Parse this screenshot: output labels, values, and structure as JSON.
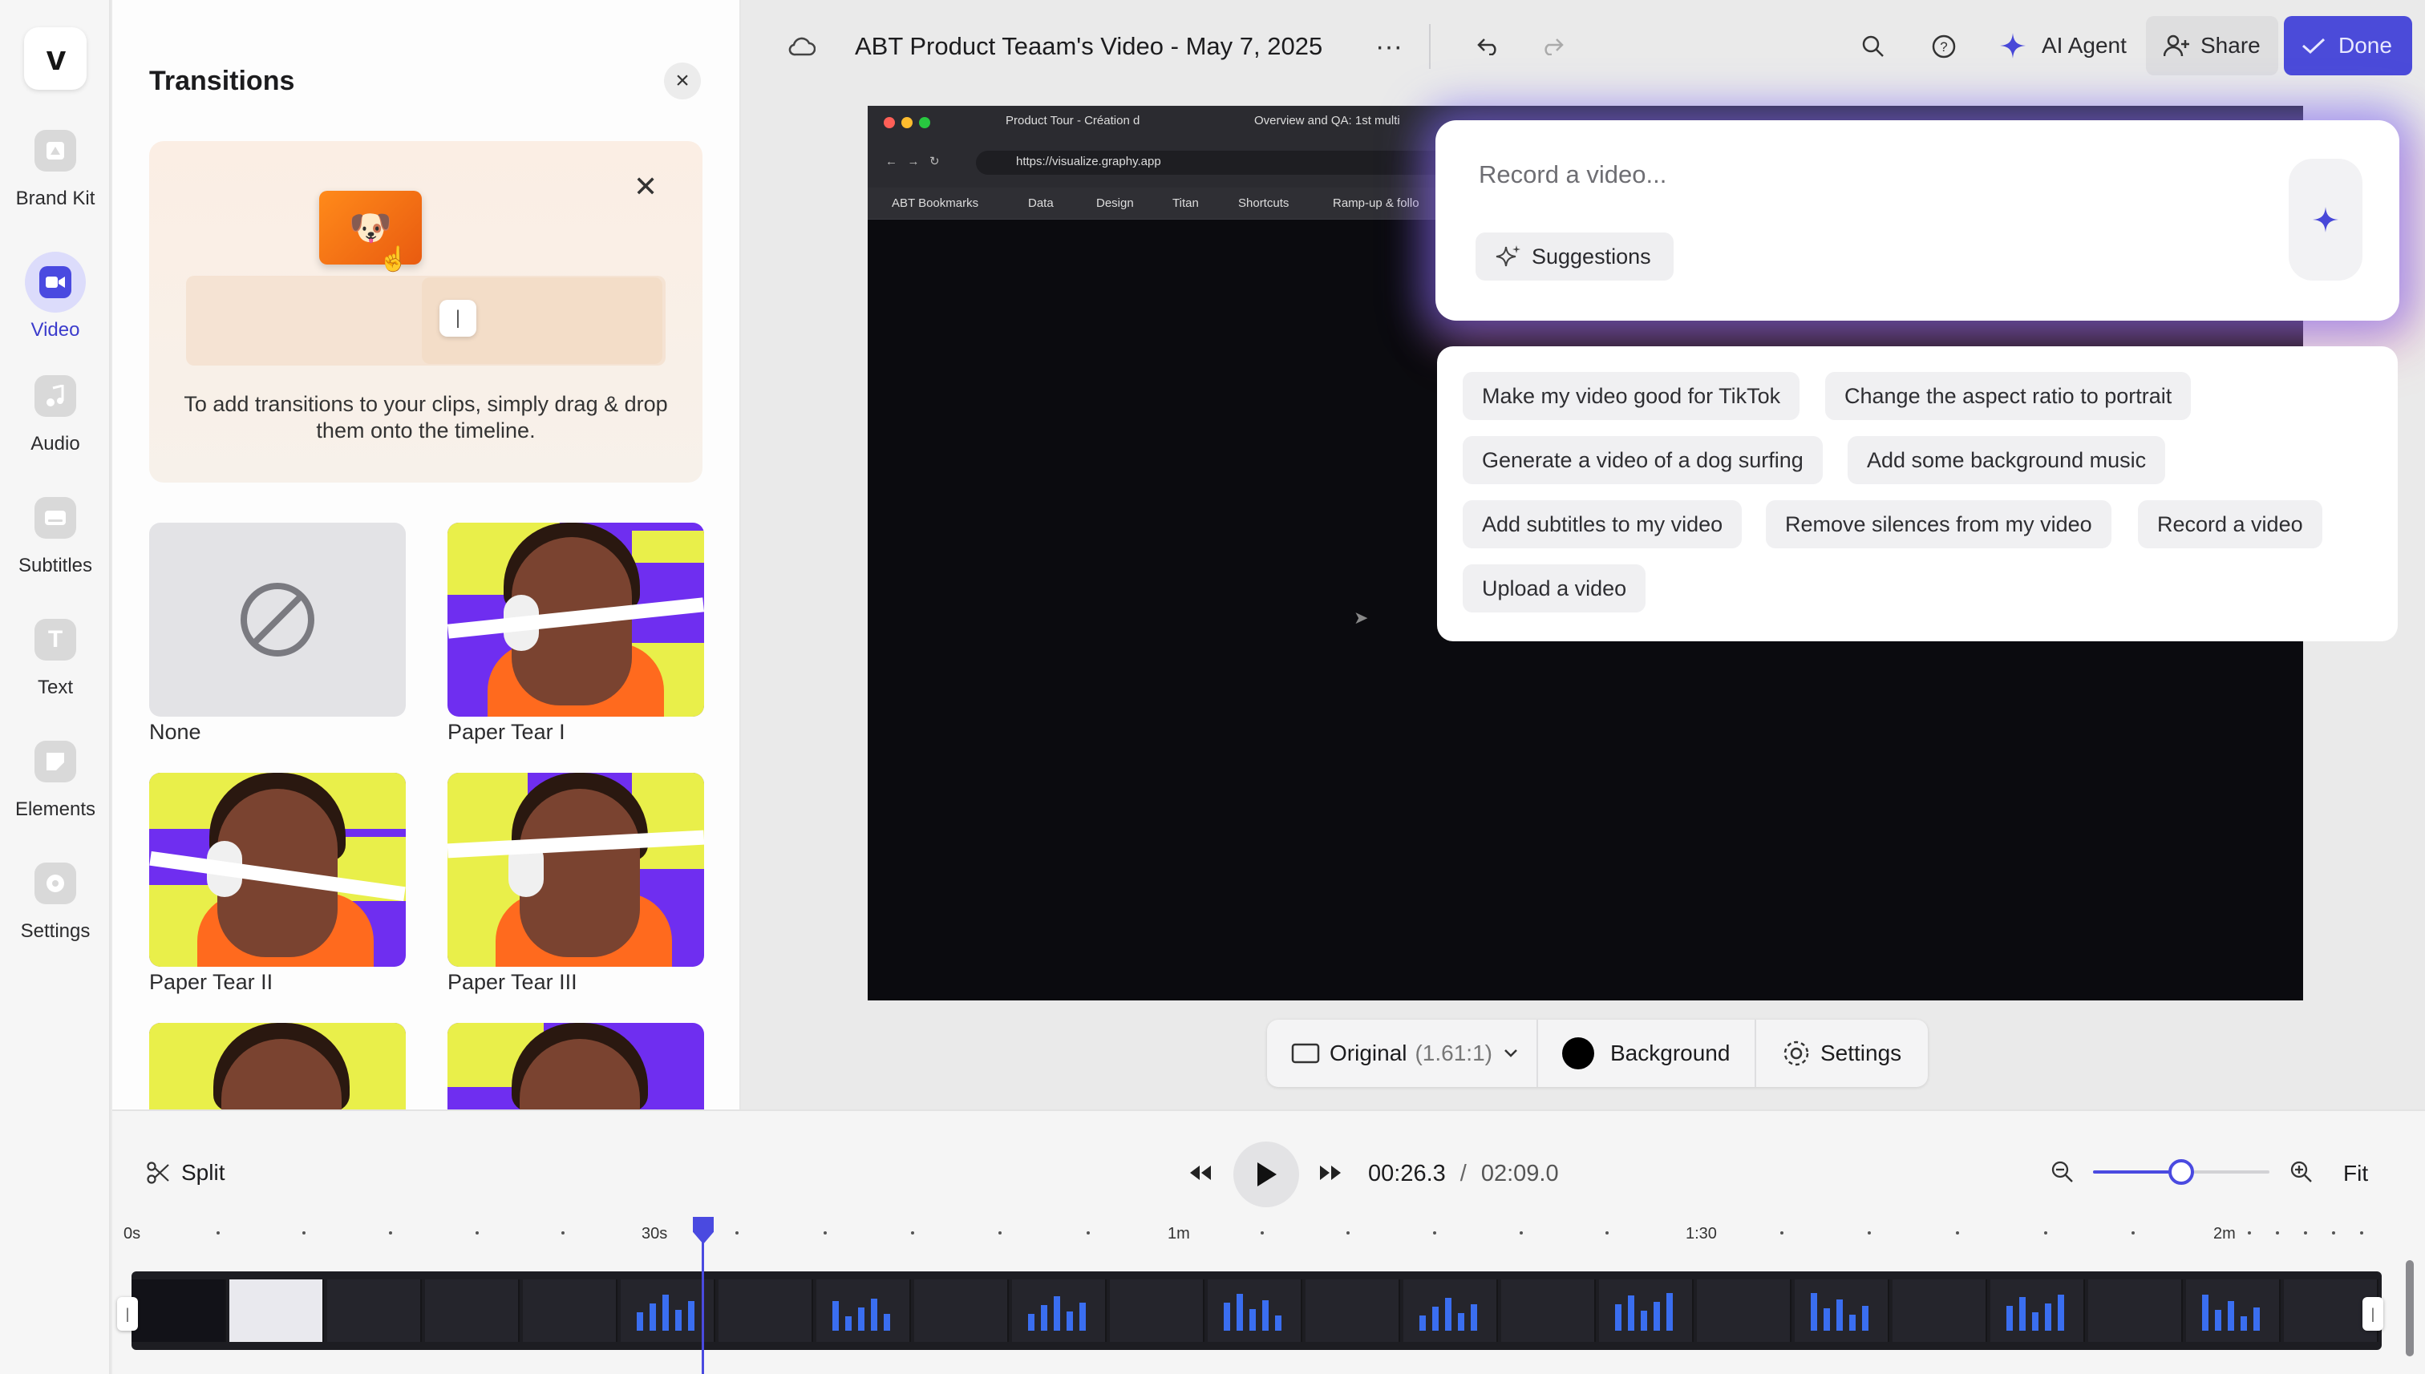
{
  "rail": {
    "logo": "v",
    "items": [
      {
        "label": "Brand Kit",
        "icon": "brand-kit-icon"
      },
      {
        "label": "Video",
        "icon": "video-icon",
        "active": true
      },
      {
        "label": "Audio",
        "icon": "music-note-icon"
      },
      {
        "label": "Subtitles",
        "icon": "subtitles-icon"
      },
      {
        "label": "Text",
        "icon": "text-icon"
      },
      {
        "label": "Elements",
        "icon": "elements-icon"
      },
      {
        "label": "Settings",
        "icon": "settings-icon"
      }
    ]
  },
  "panel": {
    "title": "Transitions",
    "close": "×",
    "hint_text": "To add transitions to your clips, simply drag & drop them onto the timeline.",
    "hint_close": "✕",
    "transitions": [
      {
        "label": "None"
      },
      {
        "label": "Paper Tear I"
      },
      {
        "label": "Paper Tear II"
      },
      {
        "label": "Paper Tear III"
      }
    ]
  },
  "topbar": {
    "title": "ABT Product Teaam's Video - May 7, 2025",
    "more": "···",
    "ai_agent": "AI Agent",
    "share": "Share",
    "done": "Done"
  },
  "browser": {
    "tab1": "Product Tour - Création d",
    "tab2": "Overview and QA: 1st multi",
    "url": "https://visualize.graphy.app",
    "bookmarks": [
      "ABT Bookmarks",
      "Data",
      "Design",
      "Titan",
      "Shortcuts",
      "Ramp-up & follo"
    ]
  },
  "ai": {
    "placeholder": "Record a video...",
    "suggestions_btn": "Suggestions",
    "chips": [
      "Make my video good for TikTok",
      "Change the aspect ratio to portrait",
      "Generate a video of a dog surfing",
      "Add some background music",
      "Add subtitles to my video",
      "Remove silences from my video",
      "Record a video",
      "Upload a video"
    ]
  },
  "format_bar": {
    "aspect": "Original",
    "ratio": "(1.61:1)",
    "background": "Background",
    "settings": "Settings"
  },
  "timeline": {
    "split": "Split",
    "current_time": "00:26.3",
    "separator": "/",
    "total_time": "02:09.0",
    "fit": "Fit",
    "zoom_level": 0.5,
    "ruler": [
      "0s",
      "30s",
      "1m",
      "1:30",
      "2m"
    ]
  },
  "colors": {
    "accent": "#4a4ae0",
    "done_bg": "#4b4bd9"
  }
}
